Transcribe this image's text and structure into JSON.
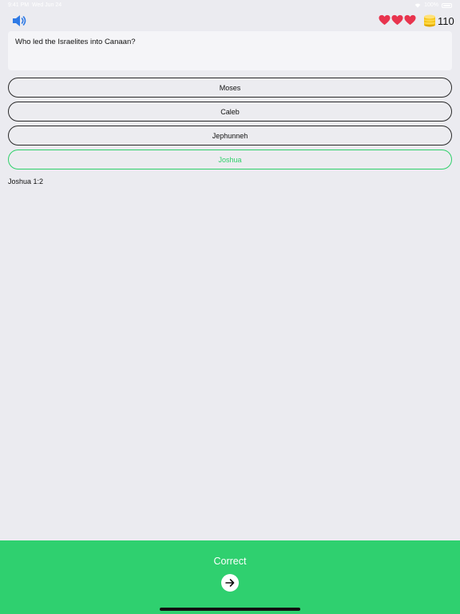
{
  "status_bar": {
    "time": "9:41 PM",
    "date": "Wed Jun 24",
    "battery": "100%"
  },
  "header": {
    "sound_icon": "speaker-icon",
    "lives_icon": "heart-icon",
    "lives": 3,
    "coins_icon": "coin-stack-icon",
    "coins": "110",
    "colors": {
      "sound": "#2f7ae5",
      "heart": "#e8344e",
      "coin": "#f5c518"
    }
  },
  "question": {
    "text": "Who led the Israelites into Canaan?"
  },
  "answers": [
    {
      "label": "Moses"
    },
    {
      "label": "Caleb"
    },
    {
      "label": "Jephunneh"
    },
    {
      "label": "Joshua",
      "state": "correct"
    }
  ],
  "reference": "Joshua 1:2",
  "result": {
    "label": "Correct",
    "next_icon": "arrow-right-icon",
    "color": "#2fd06f"
  }
}
